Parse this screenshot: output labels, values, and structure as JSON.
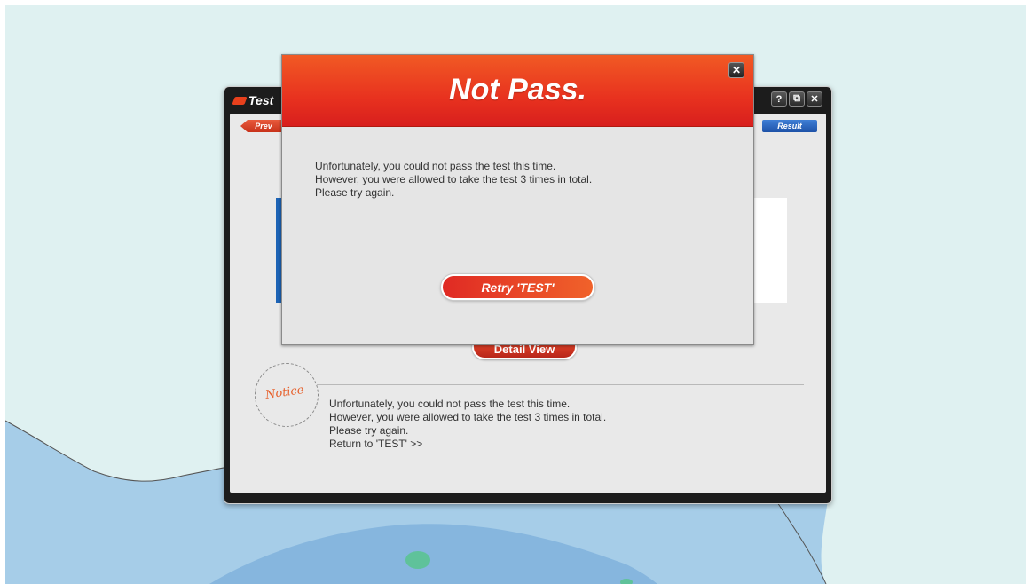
{
  "window": {
    "title": "Test",
    "help_label": "?",
    "restore_label": "⧉",
    "close_label": "✕",
    "prev_label": "Prev",
    "result_label": "Result",
    "detail_view_label": "Detail View",
    "notice_badge": "Notice",
    "notice_lines": [
      "Unfortunately, you could not pass the test this time.",
      "However, you were allowed to take the test 3 times in total.",
      "Please try again.",
      "Return to 'TEST' >>"
    ]
  },
  "modal": {
    "title": "Not Pass.",
    "close_label": "✕",
    "message_lines": [
      "Unfortunately, you could not pass the test this time.",
      "However, you were allowed to take the test 3 times in total.",
      "Please try again."
    ],
    "retry_label": "Retry 'TEST'"
  },
  "colors": {
    "accent_red": "#e8321f",
    "accent_blue": "#1d63b5",
    "notice_orange": "#e7602b"
  }
}
